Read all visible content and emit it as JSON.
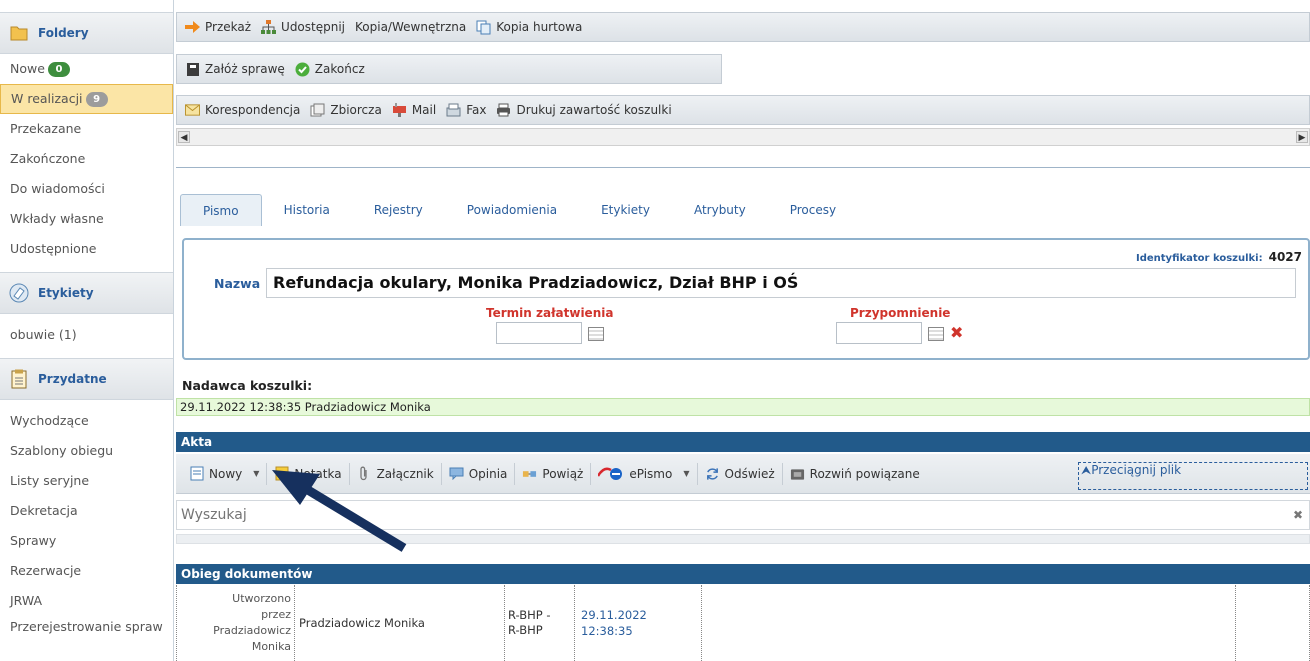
{
  "sidebar": {
    "foldery": {
      "title": "Foldery",
      "items": [
        {
          "label": "Nowe",
          "badge": "0"
        },
        {
          "label": "W realizacji",
          "badge": "9"
        },
        {
          "label": "Przekazane"
        },
        {
          "label": "Zakończone"
        },
        {
          "label": "Do wiadomości"
        },
        {
          "label": "Wkłady własne"
        },
        {
          "label": "Udostępnione"
        }
      ]
    },
    "etykiety": {
      "title": "Etykiety",
      "items": [
        {
          "label": "obuwie (1)"
        }
      ]
    },
    "przydatne": {
      "title": "Przydatne",
      "items": [
        {
          "label": "Wychodzące"
        },
        {
          "label": "Szablony obiegu"
        },
        {
          "label": "Listy seryjne"
        },
        {
          "label": "Dekretacja"
        },
        {
          "label": "Sprawy"
        },
        {
          "label": "Rezerwacje"
        },
        {
          "label": "JRWA"
        },
        {
          "label": "Przerejestrowanie spraw"
        }
      ]
    }
  },
  "toolbar1": {
    "przekaz": "Przekaż",
    "udostepnij": "Udostępnij",
    "kopia_wewn": "Kopia/Wewnętrzna",
    "kopia_hurt": "Kopia hurtowa"
  },
  "toolbar2": {
    "zaloz": "Załóż sprawę",
    "zakoncz": "Zakończ"
  },
  "toolbar3": {
    "korespondencja": "Korespondencja",
    "zbiorcza": "Zbiorcza",
    "mail": "Mail",
    "fax": "Fax",
    "drukuj": "Drukuj zawartość koszulki"
  },
  "tabs": [
    "Pismo",
    "Historia",
    "Rejestry",
    "Powiadomienia",
    "Etykiety",
    "Atrybuty",
    "Procesy"
  ],
  "form": {
    "ident_label": "Identyfikator koszulki:",
    "ident_value": "4027",
    "nazwa_label": "Nazwa",
    "nazwa_value": "Refundacja okulary, Monika Pradziadowicz, Dział BHP i OŚ",
    "termin_label": "Termin załatwienia",
    "przypomnienie_label": "Przypomnienie"
  },
  "nadawca": {
    "label": "Nadawca koszulki:",
    "value": "29.11.2022 12:38:35   Pradziadowicz Monika"
  },
  "akta": {
    "title": "Akta",
    "buttons": {
      "nowy": "Nowy",
      "notatka": "Notatka",
      "zalacznik": "Załącznik",
      "opinia": "Opinia",
      "powiaz": "Powiąż",
      "epismo": "ePismo",
      "odswiez": "Odśwież",
      "rozwin": "Rozwiń powiązane"
    },
    "drag": "Przeciągnij plik",
    "search_placeholder": "Wyszukaj"
  },
  "obieg": {
    "title": "Obieg dokumentów",
    "row": {
      "created": "Utworzono przez Pradziadowicz Monika",
      "user": "Pradziadowicz Monika",
      "unit": "R-BHP - R-BHP",
      "date": "29.11.2022",
      "time": "12:38:35"
    }
  },
  "colors": {
    "accent": "#2a5d9c",
    "header_bar": "#225a8a",
    "active_item": "#fbe5a6",
    "required": "#d0342c",
    "arrow": "#16305e"
  }
}
